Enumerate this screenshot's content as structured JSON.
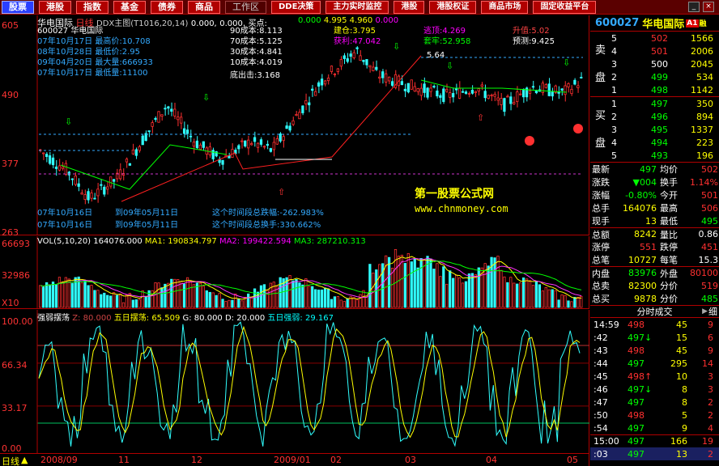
{
  "toolbar": {
    "buttons": [
      "股票",
      "港股",
      "指数",
      "基金",
      "债券",
      "商品",
      "工作区",
      "DDE决策",
      "主力实时监控",
      "港股",
      "港股权证",
      "商品市场",
      "固定收益平台"
    ],
    "close": "×",
    "minimize": "_"
  },
  "chart_header": {
    "code": "600027",
    "name": "华电国际",
    "period": "日线",
    "indicator": "DDX主图(T1016,20,14)",
    "vals": [
      "0.000,",
      "0.000,",
      "买点:"
    ],
    "stats_right": [
      "0.000",
      "4.995",
      "4.960",
      "0.000"
    ],
    "legend_mid": [
      "0.000"
    ]
  },
  "info_left": [
    "600027 华电国际",
    "07年10月17日 最高价:10.708",
    "08年10月28日 最低价:2.95",
    "09年04月20日 最大量:666933",
    "07年10月17日 最低量:11100"
  ],
  "cost": [
    "90成本:8.113",
    "70成本:5.125",
    "30成本:4.841",
    "10成本:4.019",
    "底出击:3.168"
  ],
  "cost_right": [
    "建仓:3.795",
    "获利:47.042",
    "套牢:52.958",
    "预测:9.425"
  ],
  "cost_right2": [
    "逃顶:4.269",
    "升值:5.02"
  ],
  "price_note": "5.64",
  "period_notes": [
    "07年10月16日",
    "07年10月16日"
  ],
  "period_notes2": [
    "到09年05月11日",
    "到09年05月11日"
  ],
  "period_stats": [
    "这个时间段总跌幅:-262.983%",
    "这个时间段总换手:330.662%"
  ],
  "watermark": {
    "line1": "第一股票公式网",
    "line2": "www.chnmoney.com"
  },
  "price_axis": [
    "605",
    "490",
    "377",
    "263"
  ],
  "vol_header": {
    "label": "VOL(5,10,20)",
    "total": "164076.000",
    "ma1": "MA1: 190834.797",
    "ma2": "MA2: 199422.594",
    "ma3": "MA3: 287210.313"
  },
  "vol_axis": [
    "66693",
    "32986",
    "X10"
  ],
  "osc_header": {
    "title": "强弱摆荡",
    "z": "Z: 80.000",
    "wu": "五日摆荡: 65.509",
    "g": "G: 80.000",
    "d": "D: 20.000",
    "wr": "五日强弱: 29.167"
  },
  "osc_axis": [
    "100.00",
    "66.34",
    "33.17",
    "0.00"
  ],
  "date_axis": {
    "period": "日线",
    "dates": [
      "2008/09",
      "11",
      "12",
      "2009/01",
      "02",
      "03",
      "04",
      "05"
    ]
  },
  "right": {
    "code": "600027",
    "name": "华电国际",
    "tag": "A1",
    "tag2": "融",
    "asks": [
      {
        "n": "5",
        "p": "502",
        "v": "1566"
      },
      {
        "n": "4",
        "p": "501",
        "v": "2006"
      },
      {
        "n": "3",
        "p": "500",
        "v": "2045"
      },
      {
        "n": "2",
        "p": "499",
        "v": "534"
      },
      {
        "n": "1",
        "p": "498",
        "v": "1142"
      }
    ],
    "bids": [
      {
        "n": "1",
        "p": "497",
        "v": "350"
      },
      {
        "n": "2",
        "p": "496",
        "v": "894"
      },
      {
        "n": "3",
        "p": "495",
        "v": "1337"
      },
      {
        "n": "4",
        "p": "494",
        "v": "223"
      },
      {
        "n": "5",
        "p": "493",
        "v": "196"
      }
    ],
    "ask_label": [
      "卖",
      "盘"
    ],
    "bid_label": [
      "买",
      "盘"
    ],
    "quote": [
      [
        "最新",
        "497",
        "均价",
        "502"
      ],
      [
        "涨跌",
        "▼004",
        "换手",
        "1.14%"
      ],
      [
        "涨幅",
        "-0.80%",
        "今开",
        "501"
      ],
      [
        "总手",
        "164076",
        "最高",
        "506"
      ],
      [
        "现手",
        "13",
        "最低",
        "495"
      ],
      [
        "总额",
        "8242",
        "量比",
        "0.86"
      ],
      [
        "涨停",
        "551",
        "跌停",
        "451"
      ],
      [
        "总笔",
        "10727",
        "每笔",
        "15.3"
      ],
      [
        "内盘",
        "83976",
        "外盘",
        "80100"
      ],
      [
        "总卖",
        "82300",
        "分价",
        "519"
      ],
      [
        "总买",
        "9878",
        "分价",
        "485"
      ]
    ],
    "tick_tab": "分时成交",
    "tick_btn": [
      "▶",
      "细"
    ],
    "ticks": [
      [
        "14:59",
        "498",
        "45",
        "9"
      ],
      [
        ":42",
        "497↓",
        "15",
        "6"
      ],
      [
        ":43",
        "498",
        "45",
        "9"
      ],
      [
        ":44",
        "497",
        "295",
        "14"
      ],
      [
        ":45",
        "498↑",
        "10",
        "3"
      ],
      [
        ":46",
        "497↓",
        "8",
        "3"
      ],
      [
        ":47",
        "497",
        "8",
        "2"
      ],
      [
        ":50",
        "498",
        "5",
        "2"
      ],
      [
        ":54",
        "497",
        "9",
        "4"
      ],
      [
        "15:00",
        "497",
        "166",
        "19"
      ],
      [
        ":03",
        "497",
        "13",
        "2"
      ]
    ]
  },
  "colors": {
    "up": "#ff3030",
    "down": "#30ffff",
    "yellow": "#ffff00",
    "bg": "#000000"
  }
}
